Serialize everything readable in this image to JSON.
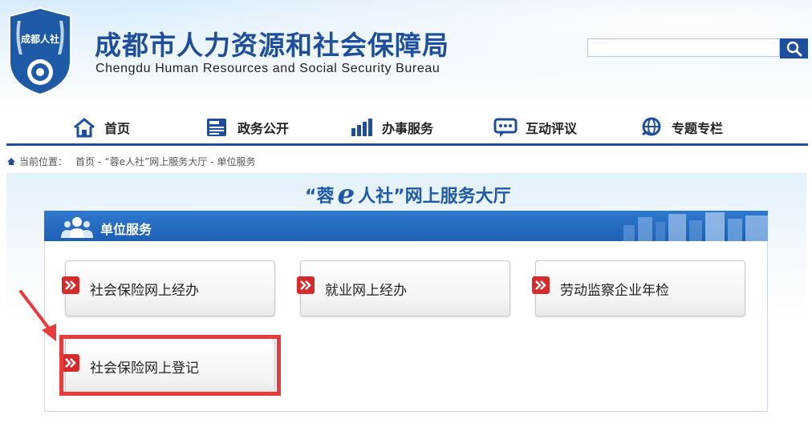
{
  "header": {
    "title_cn": "成都市人力资源和社会保障局",
    "title_en": "Chengdu Human Resources and Social Security Bureau",
    "logo_text": "成都人社",
    "search_placeholder": ""
  },
  "nav": [
    {
      "label": "首页",
      "icon": "home-icon"
    },
    {
      "label": "政务公开",
      "icon": "news-icon"
    },
    {
      "label": "办事服务",
      "icon": "bar-chart-icon"
    },
    {
      "label": "互动评议",
      "icon": "chat-icon"
    },
    {
      "label": "专题专栏",
      "icon": "globe-icon"
    }
  ],
  "breadcrumb": {
    "prefix": "当前位置：",
    "items": [
      "首页",
      "-",
      "“蓉e人社”网上服务大厅",
      "-",
      "单位服务"
    ]
  },
  "hall": {
    "title_left": "“蓉",
    "title_e": "e",
    "title_right": "人社”网上服务大厅"
  },
  "section": {
    "label": "单位服务",
    "services": [
      "社会保险网上经办",
      "就业网上经办",
      "劳动监察企业年检",
      "社会保险网上登记"
    ]
  },
  "colors": {
    "brand_blue": "#1e4f9c",
    "highlight_red": "#e83b3b"
  }
}
